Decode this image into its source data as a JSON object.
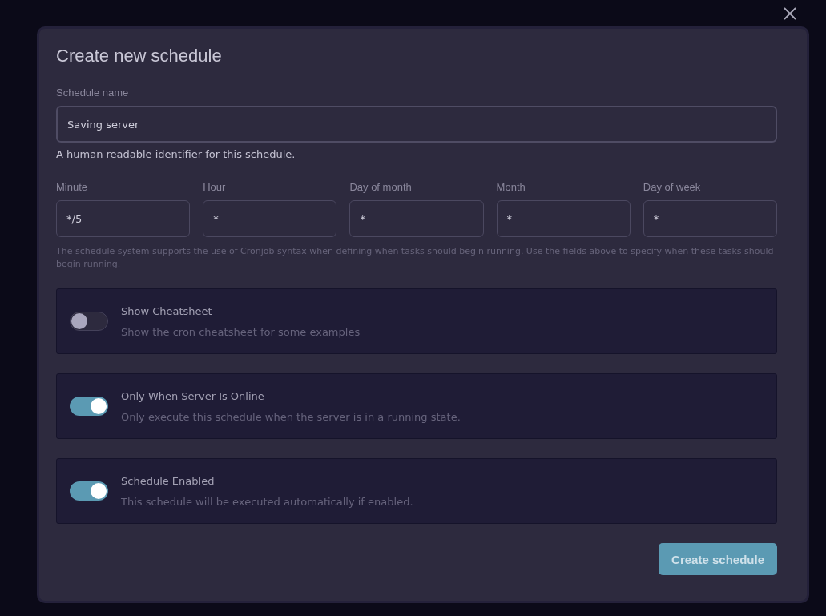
{
  "dialog": {
    "title": "Create new schedule"
  },
  "name_field": {
    "label": "Schedule name",
    "value": "Saving server",
    "help": "A human readable identifier for this schedule."
  },
  "cron_fields": [
    {
      "label": "Minute",
      "value": "*/5"
    },
    {
      "label": "Hour",
      "value": "*"
    },
    {
      "label": "Day of month",
      "value": "*"
    },
    {
      "label": "Month",
      "value": "*"
    },
    {
      "label": "Day of week",
      "value": "*"
    }
  ],
  "cron_help": "The schedule system supports the use of Cronjob syntax when defining when tasks should begin running. Use the fields above to specify when these tasks should begin running.",
  "options": [
    {
      "title": "Show Cheatsheet",
      "description": "Show the cron cheatsheet for some examples",
      "on": false
    },
    {
      "title": "Only When Server Is Online",
      "description": "Only execute this schedule when the server is in a running state.",
      "on": true
    },
    {
      "title": "Schedule Enabled",
      "description": "This schedule will be executed automatically if enabled.",
      "on": true
    }
  ],
  "submit_button": "Create schedule"
}
